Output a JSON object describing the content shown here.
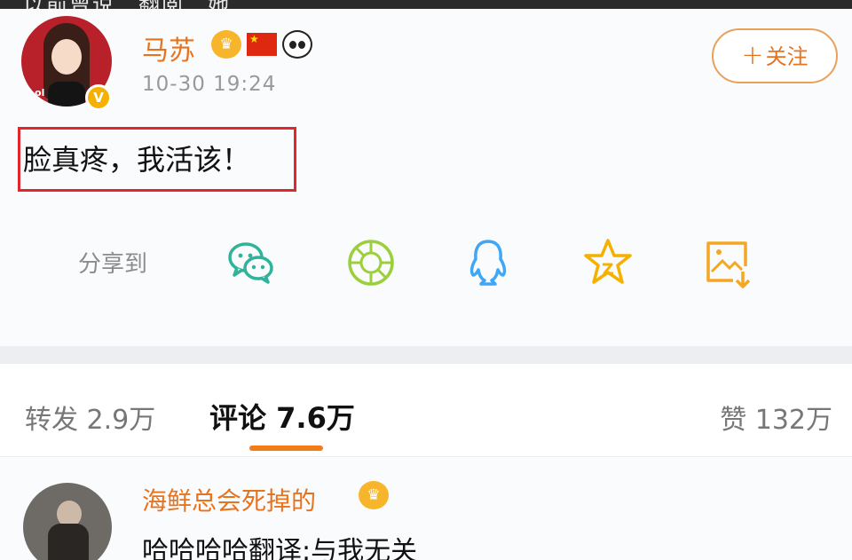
{
  "top_strip": {
    "text": "…以前曾说…翻阅…她"
  },
  "post": {
    "author": "马苏",
    "verified_mark": "V",
    "badges": {
      "crown": "♛",
      "flag": "★",
      "panda": "panda-icon"
    },
    "time": "10-30 19:24",
    "follow_button": {
      "plus": "+",
      "label": "关注"
    },
    "text": "脸真疼，我活该！"
  },
  "share": {
    "label": "分享到",
    "icons": [
      "wechat-icon",
      "moments-icon",
      "qq-icon",
      "favorite-icon",
      "save-image-icon"
    ],
    "colors": {
      "wechat": "#2fb39a",
      "moments": "#9ccf3c",
      "qq": "#3fa7f5",
      "favorite": "#f5b000",
      "save": "#f5a623"
    }
  },
  "tabs": {
    "repost": "转发 2.9万",
    "comments": "评论 7.6万",
    "likes": "赞 132万"
  },
  "comment": {
    "author": "海鲜总会死掉的",
    "badge": "♛",
    "text": "哈哈哈哈翻译:与我无关"
  },
  "colors": {
    "accent": "#e8731e",
    "highlight_box": "#e0272e",
    "tab_indicator": "#f07c1a"
  }
}
